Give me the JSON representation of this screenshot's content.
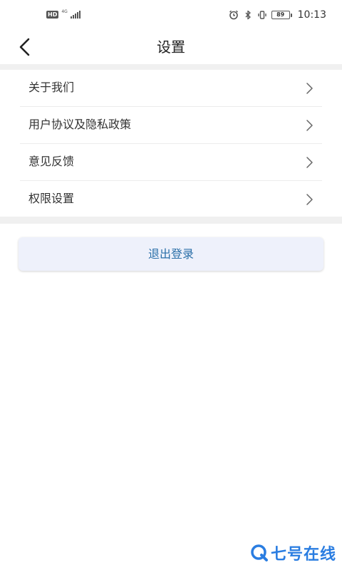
{
  "status_bar": {
    "hd": "HD",
    "network": "4G",
    "battery": "89",
    "time": "10:13"
  },
  "nav": {
    "title": "设置"
  },
  "menu": {
    "items": [
      {
        "label": "关于我们"
      },
      {
        "label": "用户协议及隐私政策"
      },
      {
        "label": "意见反馈"
      },
      {
        "label": "权限设置"
      }
    ]
  },
  "logout": {
    "label": "退出登录"
  },
  "watermark": {
    "text": "七号在线"
  },
  "colors": {
    "accent": "#2a6fa8",
    "button_bg": "#eef1fb",
    "divider": "#f0f0f0",
    "watermark": "#2a7de1"
  }
}
